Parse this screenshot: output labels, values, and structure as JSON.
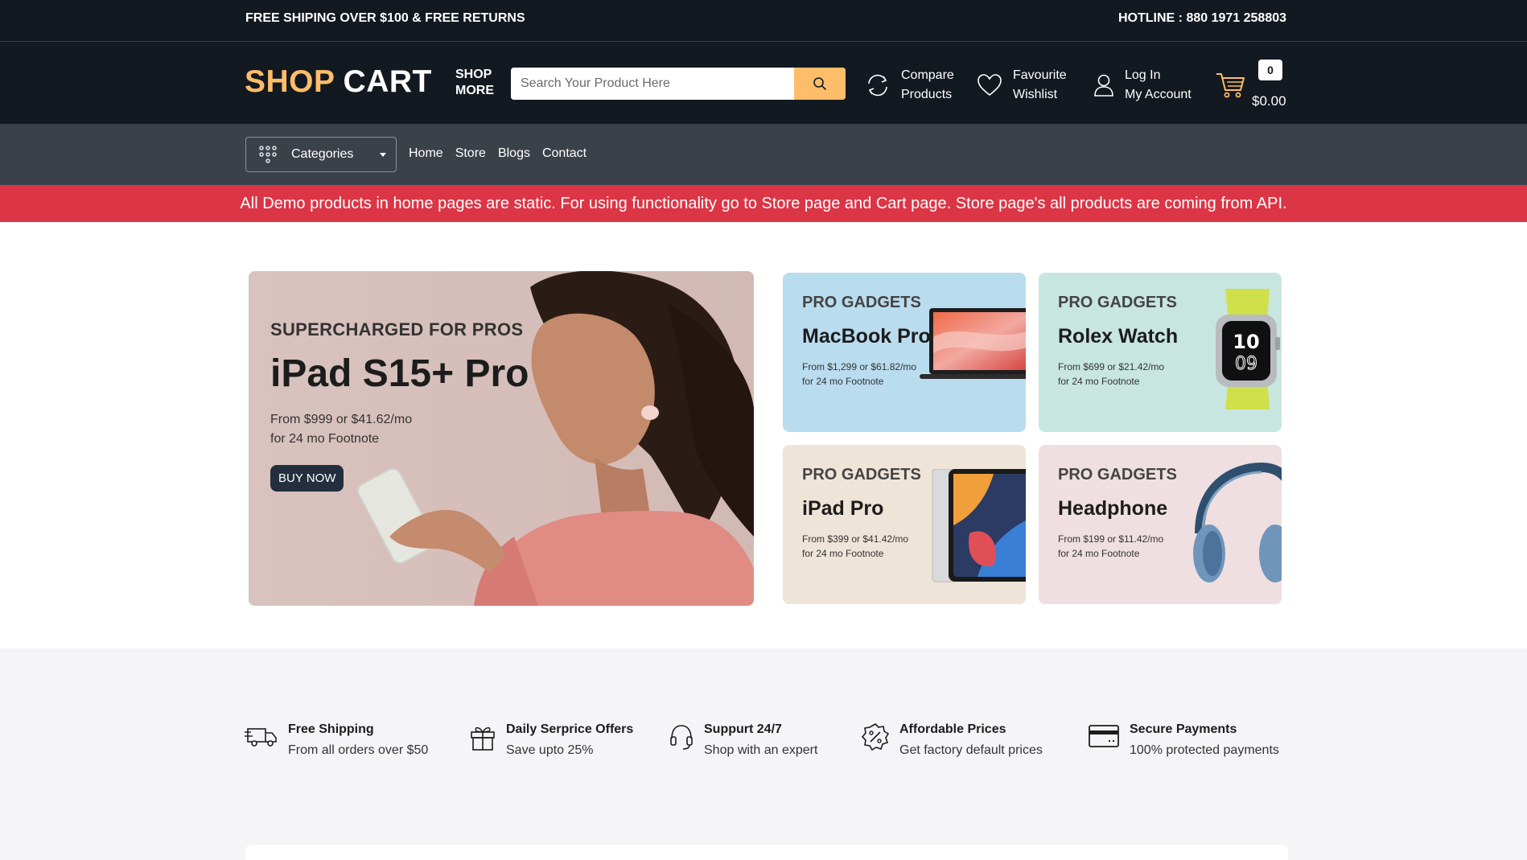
{
  "topbar": {
    "shipping_text": "FREE SHIPING OVER $100 & FREE RETURNS",
    "hotline_text": "HOTLINE : 880 1971 258803"
  },
  "header": {
    "logo_part1": "SHOP",
    "logo_part2": "CART",
    "shop_more_line1": "SHOP",
    "shop_more_line2": "MORE",
    "search_placeholder": "Search Your Product Here",
    "compare_line1": "Compare",
    "compare_line2": "Products",
    "wishlist_line1": "Favourite",
    "wishlist_line2": "Wishlist",
    "account_line1": "Log In",
    "account_line2": "My Account",
    "cart_count": "0",
    "cart_total": "$0.00"
  },
  "nav": {
    "categories_label": "Categories",
    "links": [
      "Home",
      "Store",
      "Blogs",
      "Contact"
    ]
  },
  "notice": {
    "text": "All Demo products in home pages are static. For using functionality go to Store page and Cart page. Store page's all products are coming from API."
  },
  "main_banner": {
    "kicker": "SUPERCHARGED FOR PROS",
    "title": "iPad S15+ Pro",
    "price_line1": "From $999 or $41.62/mo",
    "price_line2": "for 24 mo Footnote",
    "button_label": "BUY NOW"
  },
  "small_banners": [
    {
      "kicker": "PRO GADGETS",
      "title": "MacBook Pro",
      "price_line1": "From $1,299 or $61.82/mo",
      "price_line2": "for 24 mo Footnote",
      "bg": "#b9dcef"
    },
    {
      "kicker": "PRO GADGETS",
      "title": "Rolex Watch",
      "price_line1": "From $699 or $21.42/mo",
      "price_line2": "for 24 mo Footnote",
      "bg": "#c8e6e0"
    },
    {
      "kicker": "PRO GADGETS",
      "title": "iPad Pro",
      "price_line1": "From $399 or $41.42/mo",
      "price_line2": "for 24 mo Footnote",
      "bg": "#efe4d8"
    },
    {
      "kicker": "PRO GADGETS",
      "title": "Headphone",
      "price_line1": "From $199 or $11.42/mo",
      "price_line2": "for 24 mo Footnote",
      "bg": "#efdfe0"
    }
  ],
  "services": [
    {
      "title": "Free Shipping",
      "subtitle": "From all orders over $50",
      "icon": "truck-icon"
    },
    {
      "title": "Daily Serprice Offers",
      "subtitle": "Save upto 25%",
      "icon": "gift-icon"
    },
    {
      "title": "Suppurt 24/7",
      "subtitle": "Shop with an expert",
      "icon": "headset-icon"
    },
    {
      "title": "Affordable Prices",
      "subtitle": "Get factory default prices",
      "icon": "discount-badge-icon"
    },
    {
      "title": "Secure Payments",
      "subtitle": "100% protected payments",
      "icon": "credit-card-icon"
    }
  ],
  "colors": {
    "dark": "#131921",
    "nav": "#3b4149",
    "accent": "#febd69",
    "notice": "#dc3545"
  }
}
